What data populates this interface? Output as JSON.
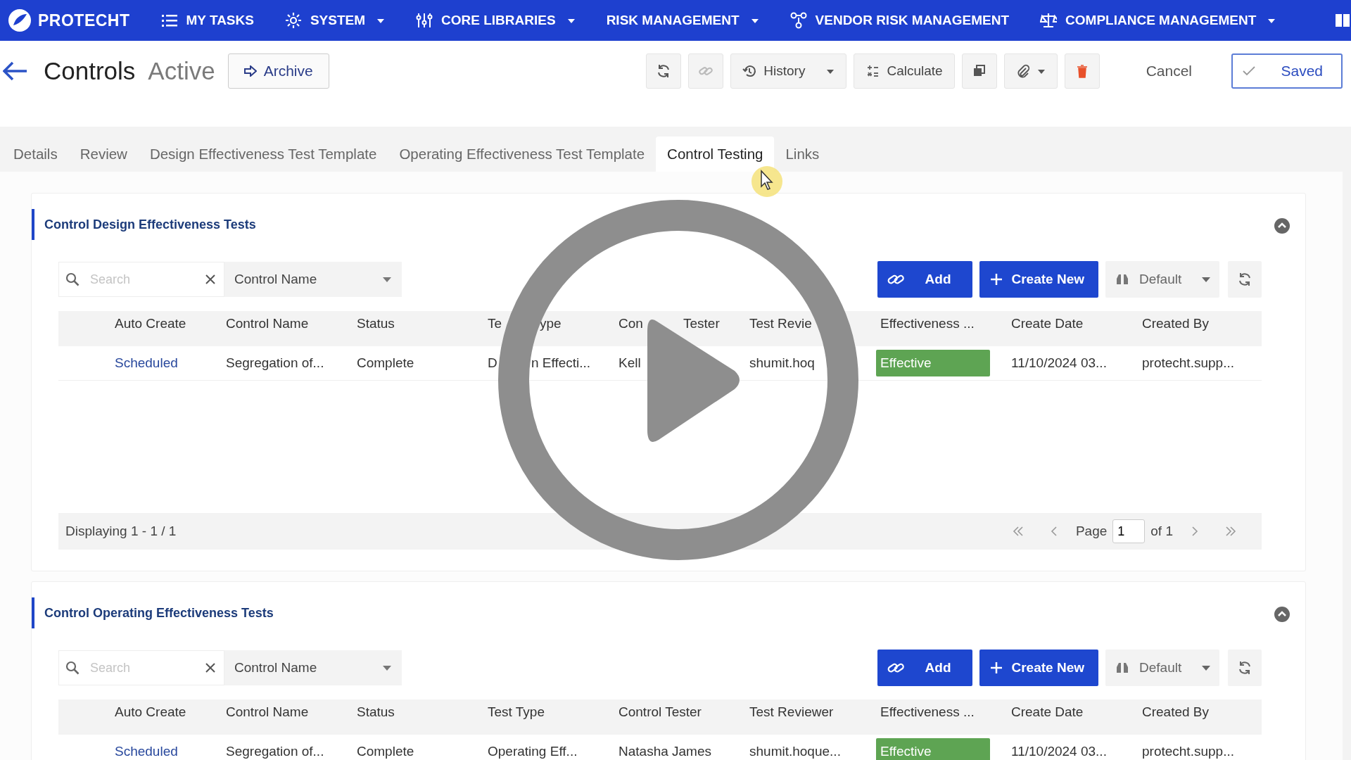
{
  "nav": {
    "logo": "PROTECHT",
    "items": [
      {
        "label": "MY TASKS",
        "dropdown": false
      },
      {
        "label": "SYSTEM",
        "dropdown": true
      },
      {
        "label": "CORE LIBRARIES",
        "dropdown": true
      },
      {
        "label": "RISK MANAGEMENT",
        "dropdown": true
      },
      {
        "label": "VENDOR RISK MANAGEMENT",
        "dropdown": false
      },
      {
        "label": "COMPLIANCE MANAGEMENT",
        "dropdown": true
      }
    ]
  },
  "header": {
    "title": "Controls",
    "status": "Active",
    "archive_button": "Archive",
    "history_button": "History",
    "calculate_button": "Calculate",
    "cancel_button": "Cancel",
    "saved_button": "Saved"
  },
  "tabs": [
    {
      "label": "Details",
      "selected": false
    },
    {
      "label": "Review",
      "selected": false
    },
    {
      "label": "Design Effectiveness Test Template",
      "selected": false
    },
    {
      "label": "Operating Effectiveness Test Template",
      "selected": false
    },
    {
      "label": "Control Testing",
      "selected": true
    },
    {
      "label": "Links",
      "selected": false
    }
  ],
  "sections": [
    {
      "title": "Control Design Effectiveness Tests",
      "expanded": true,
      "search": {
        "placeholder": "Search"
      },
      "filter": "Control Name",
      "add_button": "Add",
      "create_button": "Create New",
      "view_button": "Default",
      "columns": [
        "Auto Create",
        "Control Name",
        "Status",
        [
          "Te",
          "ype"
        ],
        [
          "Con",
          "Tester"
        ],
        "Test Revie",
        "Effectiveness ...",
        "Create Date",
        "Created By"
      ],
      "rows": [
        {
          "cells": [
            "Scheduled",
            "Segregation of...",
            "Complete",
            [
              "D",
              "n Effecti..."
            ],
            "Kell",
            "shumit.hoq",
            "Effective",
            "11/10/2024 03...",
            "protecht.supp..."
          ]
        }
      ],
      "footer": {
        "displaying": "Displaying 1 - 1 / 1",
        "page_label": "Page",
        "page": "1",
        "of": "of 1"
      }
    },
    {
      "title": "Control Operating Effectiveness Tests",
      "expanded": true,
      "search": {
        "placeholder": "Search"
      },
      "filter": "Control Name",
      "add_button": "Add",
      "create_button": "Create New",
      "view_button": "Default",
      "columns": [
        "Auto Create",
        "Control Name",
        "Status",
        "Test Type",
        "Control Tester",
        "Test Reviewer",
        "Effectiveness ...",
        "Create Date",
        "Created By"
      ],
      "rows": [
        {
          "cells": [
            "Scheduled",
            "Segregation of...",
            "Complete",
            "Operating Eff...",
            "Natasha James",
            "shumit.hoque...",
            "Effective",
            "11/10/2024 03...",
            "protecht.supp..."
          ]
        }
      ]
    }
  ]
}
